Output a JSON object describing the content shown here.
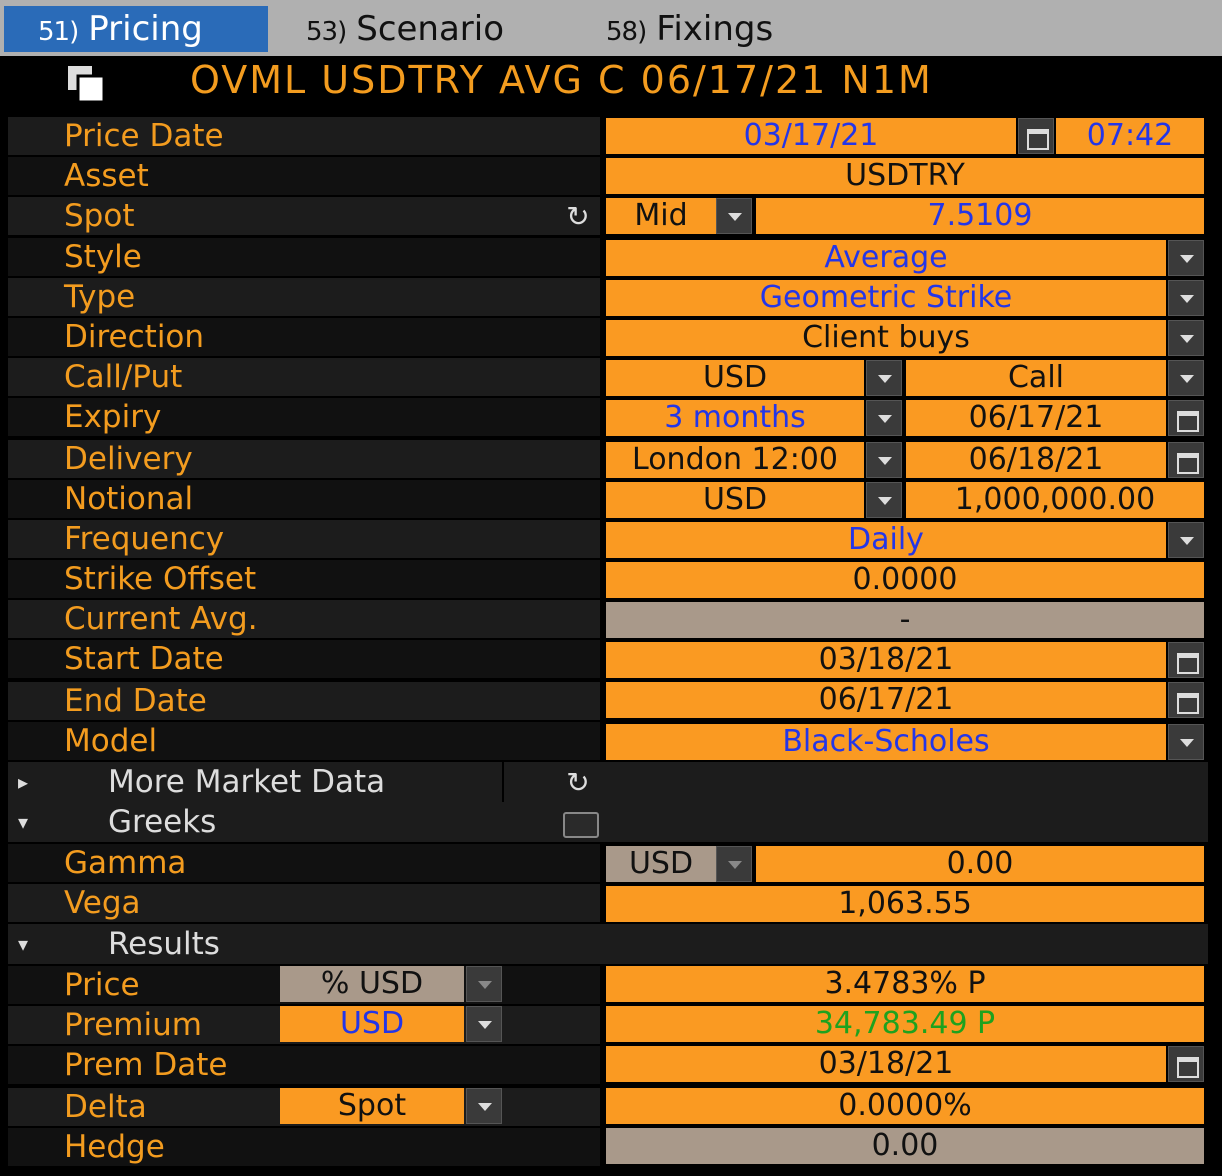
{
  "tabs": [
    {
      "num": "51)",
      "label": "Pricing"
    },
    {
      "num": "53)",
      "label": "Scenario"
    },
    {
      "num": "58)",
      "label": "Fixings"
    }
  ],
  "title": "OVML USDTRY AVG C 06/17/21 N1M",
  "fields": {
    "price_date": {
      "label": "Price Date",
      "date": "03/17/21",
      "time": "07:42"
    },
    "asset": {
      "label": "Asset",
      "value": "USDTRY"
    },
    "spot": {
      "label": "Spot",
      "side": "Mid",
      "value": "7.5109"
    },
    "style": {
      "label": "Style",
      "value": "Average"
    },
    "type": {
      "label": "Type",
      "value": "Geometric Strike"
    },
    "direction": {
      "label": "Direction",
      "value": "Client buys"
    },
    "call_put": {
      "label": "Call/Put",
      "ccy": "USD",
      "value": "Call"
    },
    "expiry": {
      "label": "Expiry",
      "tenor": "3 months",
      "date": "06/17/21"
    },
    "delivery": {
      "label": "Delivery",
      "cut": "London 12:00",
      "date": "06/18/21"
    },
    "notional": {
      "label": "Notional",
      "ccy": "USD",
      "value": "1,000,000.00"
    },
    "frequency": {
      "label": "Frequency",
      "value": "Daily"
    },
    "strike_offset": {
      "label": "Strike Offset",
      "value": "0.0000"
    },
    "current_avg": {
      "label": "Current Avg.",
      "value": "-"
    },
    "start_date": {
      "label": "Start Date",
      "value": "03/18/21"
    },
    "end_date": {
      "label": "End Date",
      "value": "06/17/21"
    },
    "model": {
      "label": "Model",
      "value": "Black-Scholes"
    }
  },
  "sections": {
    "more_market_data": "More Market Data",
    "greeks": "Greeks",
    "results": "Results"
  },
  "greeks": {
    "gamma": {
      "label": "Gamma",
      "ccy": "USD",
      "value": "0.00"
    },
    "vega": {
      "label": "Vega",
      "value": "1,063.55"
    }
  },
  "results": {
    "price": {
      "label": "Price",
      "unit": "% USD",
      "value": "3.4783% P"
    },
    "premium": {
      "label": "Premium",
      "ccy": "USD",
      "value": "34,783.49 P"
    },
    "prem_date": {
      "label": "Prem Date",
      "value": "03/18/21"
    },
    "delta": {
      "label": "Delta",
      "basis": "Spot",
      "value": "0.0000%"
    },
    "hedge": {
      "label": "Hedge",
      "value": "0.00"
    }
  },
  "colors": {
    "accent": "#f39c1f",
    "field": "#fa9a22",
    "blue_text": "#2436e8",
    "green_text": "#1ea21e",
    "tab_active": "#2a6bb8"
  }
}
